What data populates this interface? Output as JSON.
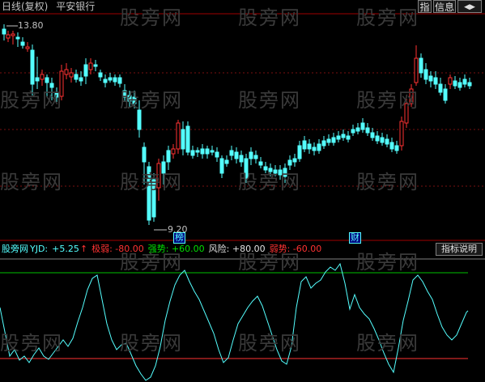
{
  "header": {
    "chart_mode": "日线(复权)",
    "stock_name": "平安银行",
    "btn_index": "指",
    "btn_info": "信息",
    "btn_nav": "◀▶"
  },
  "watermark": "股旁网",
  "price_chart": {
    "high_label": "13.80",
    "low_label": "9.20",
    "marker_bang": "榜",
    "marker_cai": "财"
  },
  "indicator": {
    "source": "股旁网",
    "name": "YJD:",
    "value": "+5.25",
    "arrow": "↑",
    "weak_extreme": "极弱: -80.00",
    "strong": "强势: +60.00",
    "risk": "风险: +80.00",
    "weak": "弱势: -60.00",
    "help_button": "指标说明"
  },
  "colors": {
    "up": "#ff3232",
    "down": "#54ffff",
    "risk_line": "#00c000",
    "weak_line": "#ff3232",
    "yjd_line": "#54ffff",
    "grid": "#7a1010"
  }
}
